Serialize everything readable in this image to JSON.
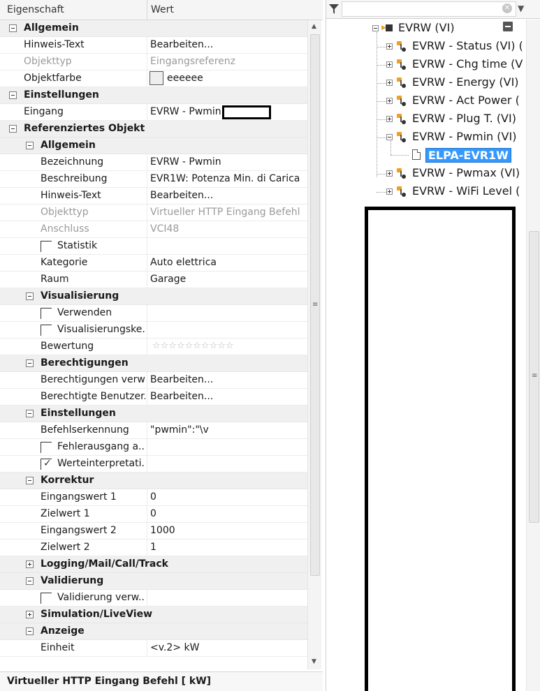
{
  "grid": {
    "col_property": "Eigenschaft",
    "col_value": "Wert",
    "rows": [
      {
        "kind": "cat",
        "indent": 0,
        "expanded": true,
        "label": "Allgemein"
      },
      {
        "kind": "prop",
        "indent": 0,
        "label": "Hinweis-Text",
        "value": "Bearbeiten..."
      },
      {
        "kind": "prop",
        "indent": 0,
        "label": "Objekttyp",
        "value": "Eingangsreferenz",
        "readonly": true
      },
      {
        "kind": "prop",
        "indent": 0,
        "label": "Objektfarbe",
        "value": "eeeeee",
        "swatch": "#eeeeee"
      },
      {
        "kind": "cat",
        "indent": 0,
        "expanded": true,
        "label": "Einstellungen"
      },
      {
        "kind": "prop",
        "indent": 0,
        "label": "Eingang",
        "value": "EVRW - Pwmin",
        "redacted": true
      },
      {
        "kind": "cat",
        "indent": 0,
        "expanded": true,
        "label": "Referenziertes Objekt"
      },
      {
        "kind": "cat",
        "indent": 1,
        "expanded": true,
        "label": "Allgemein"
      },
      {
        "kind": "prop",
        "indent": 1,
        "label": "Bezeichnung",
        "value": "EVRW - Pwmin"
      },
      {
        "kind": "prop",
        "indent": 1,
        "label": "Beschreibung",
        "value": "EVR1W: Potenza Min. di Carica"
      },
      {
        "kind": "prop",
        "indent": 1,
        "label": "Hinweis-Text",
        "value": "Bearbeiten..."
      },
      {
        "kind": "prop",
        "indent": 1,
        "label": "Objekttyp",
        "value": "Virtueller HTTP Eingang Befehl",
        "readonly": true
      },
      {
        "kind": "prop",
        "indent": 1,
        "label": "Anschluss",
        "value": "VCI48",
        "readonly": true
      },
      {
        "kind": "check",
        "indent": 1,
        "label": "Statistik",
        "checked": false,
        "value": ""
      },
      {
        "kind": "prop",
        "indent": 1,
        "label": "Kategorie",
        "value": "Auto elettrica"
      },
      {
        "kind": "prop",
        "indent": 1,
        "label": "Raum",
        "value": "Garage"
      },
      {
        "kind": "cat",
        "indent": 1,
        "expanded": true,
        "label": "Visualisierung"
      },
      {
        "kind": "check",
        "indent": 1,
        "label": "Verwenden",
        "checked": false,
        "value": ""
      },
      {
        "kind": "check",
        "indent": 1,
        "label": "Visualisierungske...",
        "checked": false,
        "value": ""
      },
      {
        "kind": "prop",
        "indent": 1,
        "label": "Bewertung",
        "value": "",
        "stars": 10
      },
      {
        "kind": "cat",
        "indent": 1,
        "expanded": true,
        "label": "Berechtigungen"
      },
      {
        "kind": "prop",
        "indent": 1,
        "label": "Berechtigungen verw...",
        "value": "Bearbeiten..."
      },
      {
        "kind": "prop",
        "indent": 1,
        "label": "Berechtigte Benutzer...",
        "value": "Bearbeiten..."
      },
      {
        "kind": "cat",
        "indent": 1,
        "expanded": true,
        "label": "Einstellungen"
      },
      {
        "kind": "prop",
        "indent": 1,
        "label": "Befehlserkennung",
        "value": "\"pwmin\":\"\\v"
      },
      {
        "kind": "check",
        "indent": 1,
        "label": "Fehlerausgang a...",
        "checked": false,
        "value": ""
      },
      {
        "kind": "check",
        "indent": 1,
        "label": "Werteinterpretati...",
        "checked": true,
        "value": ""
      },
      {
        "kind": "cat",
        "indent": 1,
        "expanded": true,
        "label": "Korrektur"
      },
      {
        "kind": "prop",
        "indent": 1,
        "label": "Eingangswert 1",
        "value": "0"
      },
      {
        "kind": "prop",
        "indent": 1,
        "label": "Zielwert 1",
        "value": "0"
      },
      {
        "kind": "prop",
        "indent": 1,
        "label": "Eingangswert 2",
        "value": "1000"
      },
      {
        "kind": "prop",
        "indent": 1,
        "label": "Zielwert 2",
        "value": "1"
      },
      {
        "kind": "cat",
        "indent": 1,
        "expanded": false,
        "label": "Logging/Mail/Call/Track"
      },
      {
        "kind": "cat",
        "indent": 1,
        "expanded": true,
        "label": "Validierung"
      },
      {
        "kind": "check",
        "indent": 1,
        "label": "Validierung verw...",
        "checked": false,
        "value": ""
      },
      {
        "kind": "cat",
        "indent": 1,
        "expanded": false,
        "label": "Simulation/LiveView"
      },
      {
        "kind": "cat",
        "indent": 1,
        "expanded": true,
        "label": "Anzeige"
      },
      {
        "kind": "prop",
        "indent": 1,
        "label": "Einheit",
        "value": "<v.2> kW"
      }
    ]
  },
  "footer": {
    "description": "Virtueller HTTP Eingang Befehl [ kW]"
  },
  "filter": {
    "placeholder": "",
    "clear_icon": "clear-icon",
    "filter_icon": "funnel-icon",
    "dropdown_icon": "chevron-down-icon"
  },
  "tree": {
    "root": {
      "label": "EVRW (VI)",
      "expanded": true
    },
    "items": [
      {
        "label": "EVRW - Status (VI) (",
        "expanded": false
      },
      {
        "label": "EVRW - Chg time (V",
        "expanded": false
      },
      {
        "label": "EVRW - Energy (VI)",
        "expanded": false
      },
      {
        "label": "EVRW - Act Power (",
        "expanded": false
      },
      {
        "label": "EVRW - Plug T. (VI)",
        "expanded": false
      },
      {
        "label": "EVRW - Pwmin (VI)",
        "expanded": true,
        "child": "ELPA-EVR1W"
      },
      {
        "label": "EVRW - Pwmax (VI)",
        "expanded": false
      },
      {
        "label": "EVRW - WiFi Level (",
        "expanded": false
      }
    ]
  },
  "colors": {
    "selection": "#3399ff",
    "category_bg": "#f0f0f0",
    "accent_pin": "#f0a020"
  }
}
